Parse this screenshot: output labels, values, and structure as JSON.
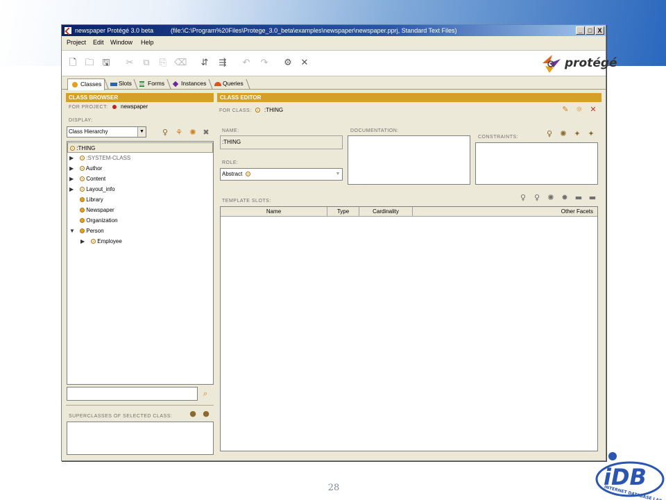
{
  "slide": {
    "page_number": "28",
    "logo_text": "iDB",
    "logo_caption": "INTERNET DATABASE LAB."
  },
  "window": {
    "title": "newspaper  Protégé 3.0 beta",
    "path": "(file:\\C:\\Program%20Files\\Protege_3.0_beta\\examples\\newspaper\\newspaper.pprj, Standard Text Files)",
    "minimize": "_",
    "maximize": "□",
    "close": "X"
  },
  "menu": [
    "Project",
    "Edit",
    "Window",
    "Help"
  ],
  "toolbar": {
    "icons": [
      "new-file-icon",
      "open-folder-icon",
      "save-icon",
      "cut-icon",
      "copy-icon",
      "paste-icon",
      "delete-icon",
      "clear-icon",
      "insert-project-icon",
      "include-project-icon",
      "undo-icon",
      "redo-icon",
      "configure-icon",
      "close-project-icon"
    ],
    "logo_text": "protégé"
  },
  "tabs": [
    {
      "label": "Classes",
      "color": "#e4a020",
      "active": true
    },
    {
      "label": "Slots",
      "color": "#2a64b0",
      "active": false
    },
    {
      "label": "Forms",
      "color": "#2e8a30",
      "active": false
    },
    {
      "label": "Instances",
      "color": "#6a2a9a",
      "active": false
    },
    {
      "label": "Queries",
      "color": "#e05020",
      "active": false
    }
  ],
  "class_browser": {
    "header": "CLASS BROWSER",
    "project_label": "FOR PROJECT:",
    "project_name": "newspaper",
    "display_label": "DISPLAY:",
    "display_value": "Class Hierarchy",
    "tree": [
      {
        "label": ":THING",
        "level": 0,
        "toggle": "",
        "selected": true,
        "meta": true
      },
      {
        "label": ":SYSTEM-CLASS",
        "level": 1,
        "toggle": "▶",
        "grey": true,
        "meta": true
      },
      {
        "label": "Author",
        "level": 1,
        "toggle": "▶",
        "meta": true
      },
      {
        "label": "Content",
        "level": 1,
        "toggle": "▶",
        "meta": true
      },
      {
        "label": "Layout_info",
        "level": 1,
        "toggle": "▶",
        "meta": true
      },
      {
        "label": "Library",
        "level": 1,
        "toggle": "",
        "meta": false
      },
      {
        "label": "Newspaper",
        "level": 1,
        "toggle": "",
        "meta": false
      },
      {
        "label": "Organization",
        "level": 1,
        "toggle": "",
        "meta": false
      },
      {
        "label": "Person",
        "level": 1,
        "toggle": "▼",
        "meta": false
      },
      {
        "label": "Employee",
        "level": 2,
        "toggle": "▶",
        "meta": true
      }
    ],
    "superclasses_label": "SUPERCLASSES OF SELECTED CLASS:"
  },
  "class_editor": {
    "header": "CLASS EDITOR",
    "for_class_label": "FOR CLASS:",
    "for_class_value": ":THING",
    "name_label": "NAME:",
    "name_value": ":THING",
    "documentation_label": "DOCUMENTATION:",
    "constraints_label": "CONSTRAINTS:",
    "role_label": "ROLE:",
    "role_value": "Abstract",
    "template_slots_label": "TEMPLATE SLOTS:",
    "columns": [
      "Name",
      "Type",
      "Cardinality",
      "Other Facets"
    ]
  }
}
